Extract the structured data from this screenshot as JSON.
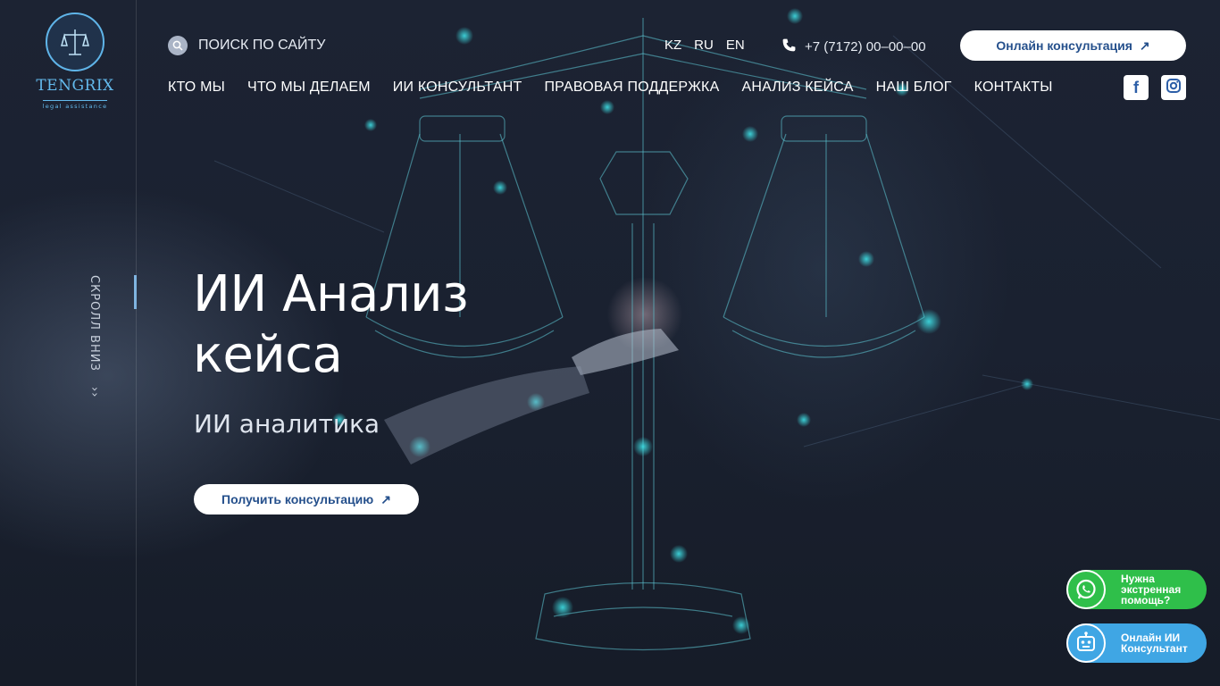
{
  "brand": {
    "name": "TENGRIX",
    "tagline": "legal assistance"
  },
  "search": {
    "label": "ПОИСК ПО САЙТУ"
  },
  "languages": [
    "KZ",
    "RU",
    "EN"
  ],
  "phone": "+7 (7172) 00–00–00",
  "header_cta": {
    "label": "Онлайн консультация"
  },
  "nav": [
    {
      "label": "КТО МЫ"
    },
    {
      "label": "ЧТО МЫ ДЕЛАЕМ"
    },
    {
      "label": "ИИ КОНСУЛЬТАНТ"
    },
    {
      "label": "ПРАВОВАЯ ПОДДЕРЖКА"
    },
    {
      "label": "АНАЛИЗ КЕЙСА"
    },
    {
      "label": "НАШ БЛОГ"
    },
    {
      "label": "КОНТАКТЫ"
    }
  ],
  "social": [
    {
      "icon": "facebook-icon"
    },
    {
      "icon": "instagram-icon"
    }
  ],
  "scroll_hint": "СКРОЛЛ ВНИЗ",
  "hero": {
    "title_line1": "ИИ Анализ",
    "title_line2": "кейса",
    "subtitle": "ИИ аналитика",
    "cta_label": "Получить консультацию"
  },
  "floating": {
    "whatsapp": {
      "label": "Нужна\nэкстренная\nпомощь?",
      "color": "#2fbf4a"
    },
    "ai": {
      "label": "Онлайн ИИ\nКонсультант",
      "color": "#3fa6e4"
    }
  },
  "colors": {
    "accent": "#25508c",
    "logo": "#63b9ec",
    "background": "#1b2230"
  }
}
